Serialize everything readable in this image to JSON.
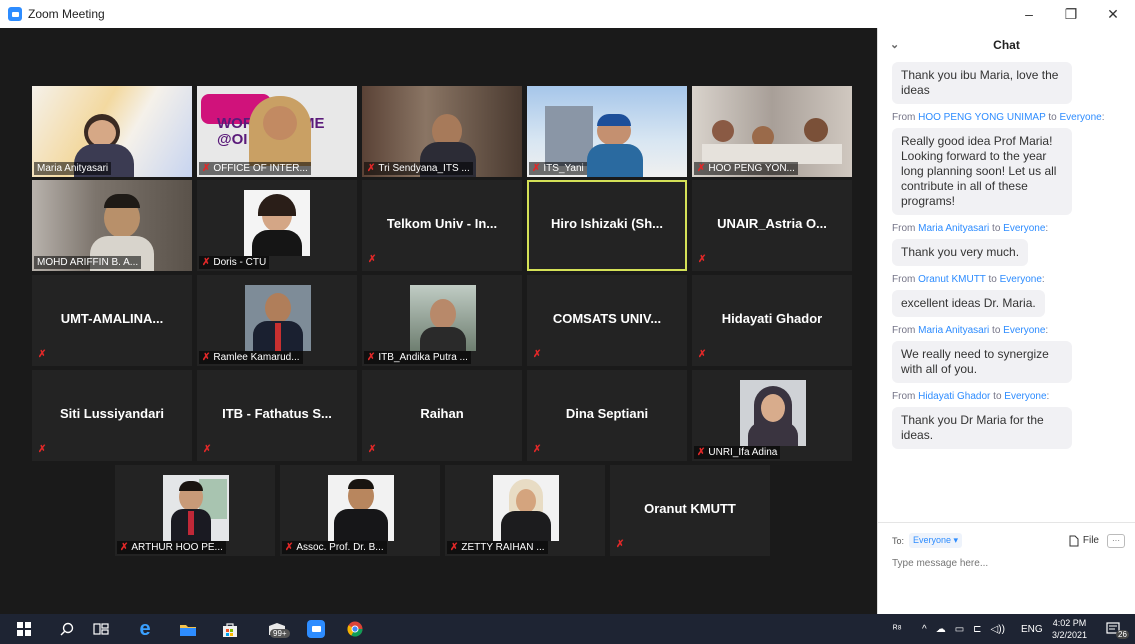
{
  "window": {
    "title": "Zoom Meeting",
    "controls": {
      "minimize": "–",
      "restore": "❐",
      "close": "✕"
    }
  },
  "gallery": {
    "active_speaker": "Hiro Ishizaki (Sh...",
    "rows": [
      [
        {
          "name": "Maria Anityasari",
          "kind": "video",
          "muted": false
        },
        {
          "name": "OFFICE OF INTER...",
          "kind": "video",
          "muted": true,
          "overlay": "WORKF    OME\n@OI      TM"
        },
        {
          "name": "Tri Sendyana_ITS ...",
          "kind": "video",
          "muted": true
        },
        {
          "name": "ITS_Yani",
          "kind": "video",
          "muted": true
        },
        {
          "name": "HOO PENG YON...",
          "kind": "video",
          "muted": true
        }
      ],
      [
        {
          "name": "MOHD ARIFFIN B. A...",
          "kind": "video",
          "muted": false
        },
        {
          "name": "Doris - CTU",
          "kind": "photo",
          "muted": true
        },
        {
          "name": "Telkom Univ - In...",
          "kind": "name",
          "muted": true
        },
        {
          "name": "Hiro Ishizaki (Sh...",
          "kind": "name",
          "muted": false
        },
        {
          "name": "UNAIR_Astria O...",
          "kind": "name",
          "muted": true
        }
      ],
      [
        {
          "name": "UMT-AMALINA...",
          "kind": "name",
          "muted": true
        },
        {
          "name": "Ramlee Kamarud...",
          "kind": "photo",
          "muted": true
        },
        {
          "name": "ITB_Andika Putra ...",
          "kind": "photo",
          "muted": true
        },
        {
          "name": "COMSATS UNIV...",
          "kind": "name",
          "muted": true
        },
        {
          "name": "Hidayati Ghador",
          "kind": "name",
          "muted": true
        }
      ],
      [
        {
          "name": "Siti Lussiyandari",
          "kind": "name",
          "muted": true
        },
        {
          "name": "ITB - Fathatus S...",
          "kind": "name",
          "muted": true
        },
        {
          "name": "Raihan",
          "kind": "name",
          "muted": true
        },
        {
          "name": "Dina Septiani",
          "kind": "name",
          "muted": true
        },
        {
          "name": "UNRI_Ifa Adina",
          "kind": "photo",
          "muted": true
        }
      ],
      [
        {
          "name": "ARTHUR HOO PE...",
          "kind": "photo",
          "muted": true
        },
        {
          "name": "Assoc. Prof. Dr. B...",
          "kind": "photo",
          "muted": true
        },
        {
          "name": "ZETTY RAIHAN ...",
          "kind": "photo",
          "muted": true
        },
        {
          "name": "Oranut KMUTT",
          "kind": "name",
          "muted": true
        }
      ]
    ]
  },
  "chat": {
    "title": "Chat",
    "messages": [
      {
        "from": "",
        "to": "",
        "text": "Thank you ibu Maria, love the ideas"
      },
      {
        "from": "HOO PENG YONG UNIMAP",
        "to": "Everyone",
        "text": "Really good idea Prof Maria! Looking forward to the year long planning soon! Let us all contribute in all of these programs!"
      },
      {
        "from": "Maria Anityasari",
        "to": "Everyone",
        "text": "Thank you very much."
      },
      {
        "from": "Oranut KMUTT",
        "to": "Everyone",
        "text": "excellent ideas Dr. Maria."
      },
      {
        "from": "Maria Anityasari",
        "to": "Everyone",
        "text": "We really need to synergize with all of you."
      },
      {
        "from": "Hidayati Ghador",
        "to": "Everyone",
        "text": "Thank you Dr Maria for the ideas."
      }
    ],
    "from_word": "From",
    "to_word": "to",
    "to_label": "To:",
    "recipient": "Everyone ▾",
    "file_label": "File",
    "more_label": "···",
    "input_placeholder": "Type message here..."
  },
  "taskbar": {
    "badge": "99+",
    "lang": "ENG",
    "time": "4:02 PM",
    "date": "3/2/2021",
    "notif_count": "26"
  },
  "colors": {
    "accent": "#2d8cff",
    "active_border": "#d4e157",
    "muted_red": "#e02828"
  }
}
